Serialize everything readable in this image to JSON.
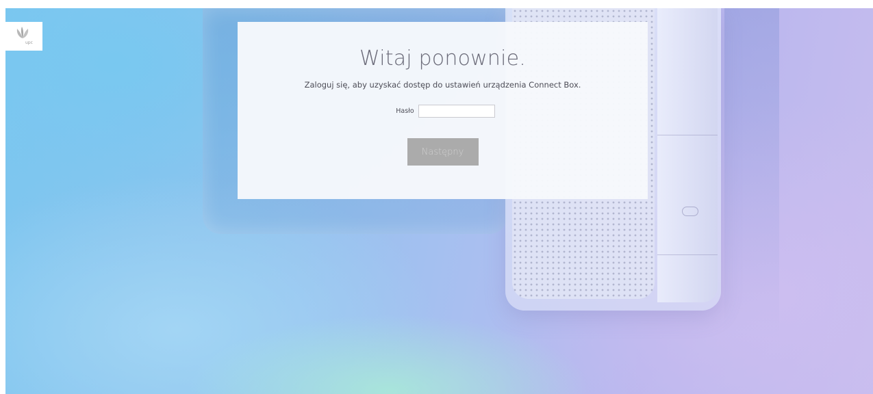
{
  "brand": {
    "logo_text": "upc"
  },
  "login": {
    "title": "Witaj ponownie.",
    "subtitle": "Zaloguj się, aby uzyskać dostęp do ustawień urządzenia Connect Box.",
    "password_label": "Hasło",
    "password_value": "",
    "next_button": "Następny"
  },
  "colors": {
    "card_background": "#f7f9fc",
    "button_background": "#ababab",
    "button_text": "#cfcfcf",
    "title_text": "#6a6a78"
  }
}
